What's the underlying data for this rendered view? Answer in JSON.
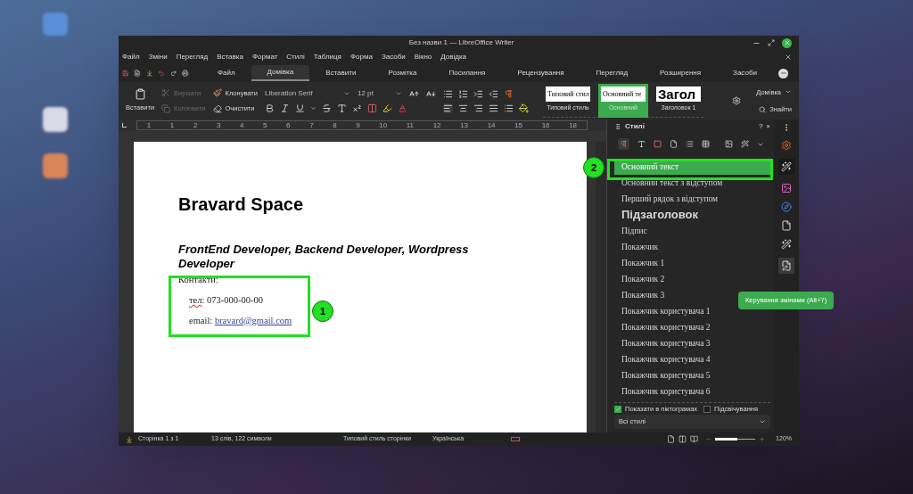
{
  "window": {
    "title": "Без назви 1 — LibreOffice Writer"
  },
  "menu": [
    "Файл",
    "Зміни",
    "Перегляд",
    "Вставка",
    "Формат",
    "Стилі",
    "Таблиця",
    "Форма",
    "Засоби",
    "Вікно",
    "Довідка"
  ],
  "tabs": [
    {
      "label": "Файл",
      "selected": false
    },
    {
      "label": "Домівка",
      "selected": true
    },
    {
      "label": "Вставити",
      "selected": false
    },
    {
      "label": "Розмітка",
      "selected": false
    },
    {
      "label": "Посилання",
      "selected": false
    },
    {
      "label": "Рецензування",
      "selected": false
    },
    {
      "label": "Перегляд",
      "selected": false
    },
    {
      "label": "Розширення",
      "selected": false
    },
    {
      "label": "Засоби",
      "selected": false
    }
  ],
  "ribbon": {
    "paste": "Вставити",
    "cut": {
      "label": "Вирізати",
      "disabled": true
    },
    "copy": {
      "label": "Копіювати",
      "disabled": true
    },
    "clone": "Клонувати",
    "clear": "Очистити",
    "font_name": "Liberation Serif",
    "font_size": "12 pt"
  },
  "style_gallery": [
    {
      "preview": "Типовий стил",
      "caption": "Типовий стиль",
      "selected": false,
      "kind": "serif"
    },
    {
      "preview": "Основний те",
      "caption": "Основний",
      "selected": true,
      "kind": "serif"
    },
    {
      "preview": "Загол",
      "caption": "Заголовок 1",
      "selected": false,
      "kind": "heading"
    }
  ],
  "deck_menu": "Домівка",
  "find": "Знайти",
  "ruler": [
    "1",
    "1",
    "2",
    "3",
    "4",
    "5",
    "6",
    "7",
    "8",
    "9",
    "10",
    "11",
    "12",
    "13",
    "14",
    "15",
    "16",
    "18"
  ],
  "document": {
    "heading": "Bravard Space",
    "subtitle": "FrontEnd Developer, Backend Developer, Wordpress Developer",
    "contacts": "Контакти:",
    "phone_label": "тел",
    "phone_value": ": 073-000-00-00",
    "email_label": "email: ",
    "email_link": "bravard@gmail.com"
  },
  "callouts": [
    "1",
    "2"
  ],
  "sidebar": {
    "title": "Стилі",
    "help": "?",
    "close": "×",
    "styles": [
      {
        "label": "Основний текст",
        "selected": true,
        "kind": "serif"
      },
      {
        "label": "Основний текст з відступом",
        "selected": false,
        "kind": "serif"
      },
      {
        "label": "Перший рядок з відступом",
        "selected": false,
        "kind": "serif"
      },
      {
        "label": "Підзаголовок",
        "selected": false,
        "kind": "heading"
      },
      {
        "label": "Підпис",
        "selected": false,
        "kind": "serif"
      },
      {
        "label": "Покажчик",
        "selected": false,
        "kind": "serif"
      },
      {
        "label": "Покажчик 1",
        "selected": false,
        "kind": "serif"
      },
      {
        "label": "Покажчик 2",
        "selected": false,
        "kind": "serif"
      },
      {
        "label": "Покажчик 3",
        "selected": false,
        "kind": "serif"
      },
      {
        "label": "Покажчик користувача 1",
        "selected": false,
        "kind": "serif"
      },
      {
        "label": "Покажчик користувача 2",
        "selected": false,
        "kind": "serif"
      },
      {
        "label": "Покажчик користувача 3",
        "selected": false,
        "kind": "serif"
      },
      {
        "label": "Покажчик користувача 4",
        "selected": false,
        "kind": "serif"
      },
      {
        "label": "Покажчик користувача 5",
        "selected": false,
        "kind": "serif"
      },
      {
        "label": "Покажчик користувача 6",
        "selected": false,
        "kind": "serif"
      }
    ],
    "show_previews": {
      "label": "Показати в піктограмах",
      "checked": true
    },
    "highlight": {
      "label": "Підсвічування",
      "checked": false
    },
    "filter": "Всі стилі"
  },
  "tooltip": "Керування змінами (Alt+7)",
  "status_bar": {
    "page": "Сторінка 1 з 1",
    "words": "13 слів, 122 символи",
    "page_style": "Типовий стиль сторінки",
    "language": "Українська",
    "zoom": "120%",
    "zoom_slider": {
      "level": 0.55
    }
  }
}
